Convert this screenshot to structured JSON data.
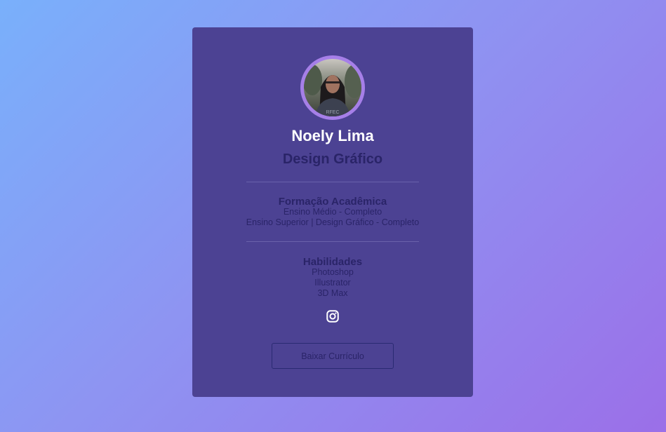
{
  "profile": {
    "name": "Noely Lima",
    "role": "Design Gráfico"
  },
  "education": {
    "title": "Formação Acadêmica",
    "items": [
      "Ensino Médio - Completo",
      "Ensino Superior | Design Gráfico - Completo"
    ]
  },
  "skills": {
    "title": "Habilidades",
    "items": [
      "Photoshop",
      "Illustrator",
      "3D Max"
    ]
  },
  "social": {
    "icon": "instagram-icon"
  },
  "actions": {
    "download_label": "Baixar Currículo"
  },
  "colors": {
    "card": "#4c4293",
    "accent_ring": "#a67fe8",
    "name_text": "#ffffff",
    "body_text": "#2a2468"
  }
}
